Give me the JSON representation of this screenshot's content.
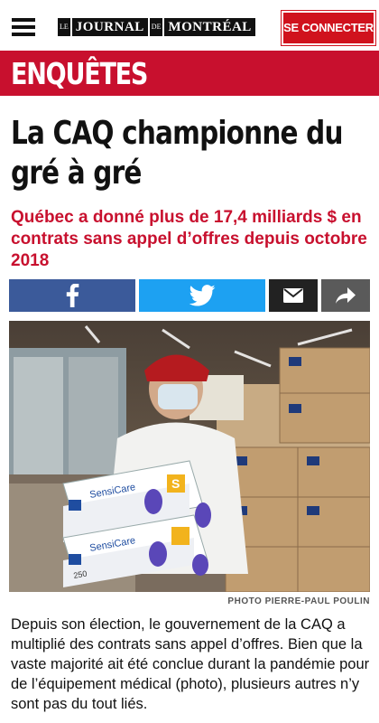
{
  "header": {
    "logo_le": "LE",
    "logo_journal": "JOURNAL",
    "logo_de": "DE",
    "logo_montreal": "MONTRÉAL",
    "connect_label": "SE CONNECTER"
  },
  "section": {
    "label": "ENQUÊTES"
  },
  "article": {
    "headline": "La CAQ championne du gré à gré",
    "subheadline": "Québec a donné plus de 17,4 milliards $ en contrats sans appel d’offres depuis octobre 2018",
    "photo_credit": "PHOTO PIERRE-PAUL POULIN",
    "photo_box_brand": "SensiCare",
    "photo_box_size": "S",
    "photo_box_count": "250",
    "body": "Depuis son élection, le gouvernement de la CAQ a multiplié des contrats sans appel d’offres. Bien que la vaste majorité ait été conclue durant la pandémie pour de l’équipement médical (photo), plusieurs autres n’y sont pas du tout liés."
  },
  "share": {
    "icons": [
      "facebook-icon",
      "twitter-icon",
      "mail-icon",
      "forward-icon"
    ]
  },
  "colors": {
    "brand_red": "#c8102e",
    "facebook": "#3b5a9a",
    "twitter": "#1da1f2"
  }
}
